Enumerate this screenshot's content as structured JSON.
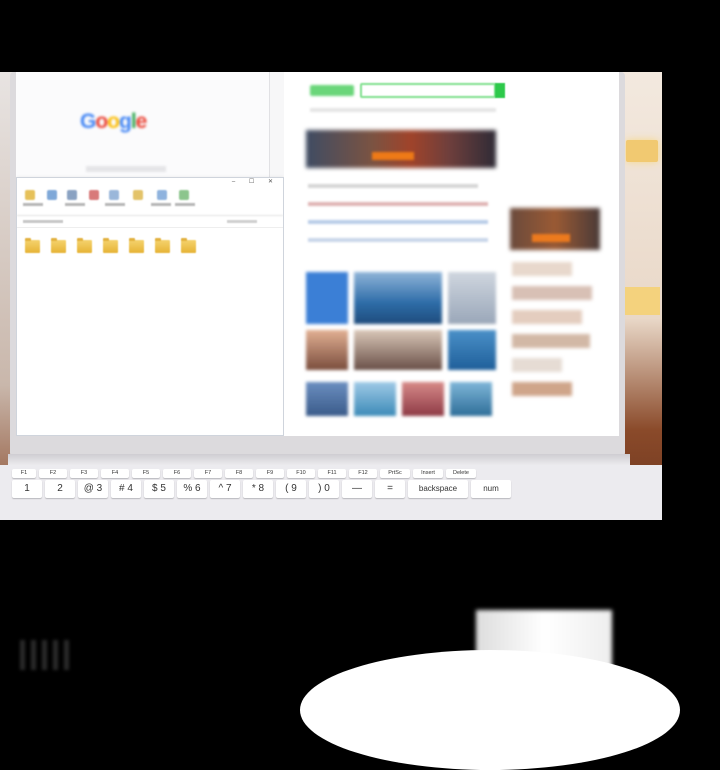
{
  "screen": {
    "left_window": {
      "logo_letters": [
        {
          "ch": "G",
          "color": "#4285f4"
        },
        {
          "ch": "o",
          "color": "#ea4335"
        },
        {
          "ch": "o",
          "color": "#fbbc05"
        },
        {
          "ch": "g",
          "color": "#4285f4"
        },
        {
          "ch": "l",
          "color": "#34a853"
        },
        {
          "ch": "e",
          "color": "#ea4335"
        }
      ]
    },
    "explorer": {
      "controls": "– ☐ ✕",
      "folder_count": 7
    },
    "browser": {
      "accent_color": "#2dc94a"
    }
  },
  "keyboard": {
    "fn_row": [
      "F1",
      "F2",
      "F3",
      "F4",
      "F5",
      "F6",
      "F7",
      "F8",
      "F9",
      "F10",
      "F11",
      "F12",
      "PrtSc",
      "Insert",
      "Delete"
    ],
    "num_row": [
      {
        "top": "",
        "main": "1"
      },
      {
        "top": "",
        "main": "2"
      },
      {
        "top": "@",
        "main": "3"
      },
      {
        "top": "#",
        "main": "4"
      },
      {
        "top": "$",
        "main": "5"
      },
      {
        "top": "%",
        "main": "6"
      },
      {
        "top": "^",
        "main": "7"
      },
      {
        "top": "*",
        "main": "8"
      },
      {
        "top": "(",
        "main": "9"
      },
      {
        "top": ")",
        "main": "0"
      },
      {
        "top": "",
        "main": "—"
      },
      {
        "top": "",
        "main": "="
      }
    ],
    "backspace_label": "backspace",
    "num_label": "num"
  }
}
